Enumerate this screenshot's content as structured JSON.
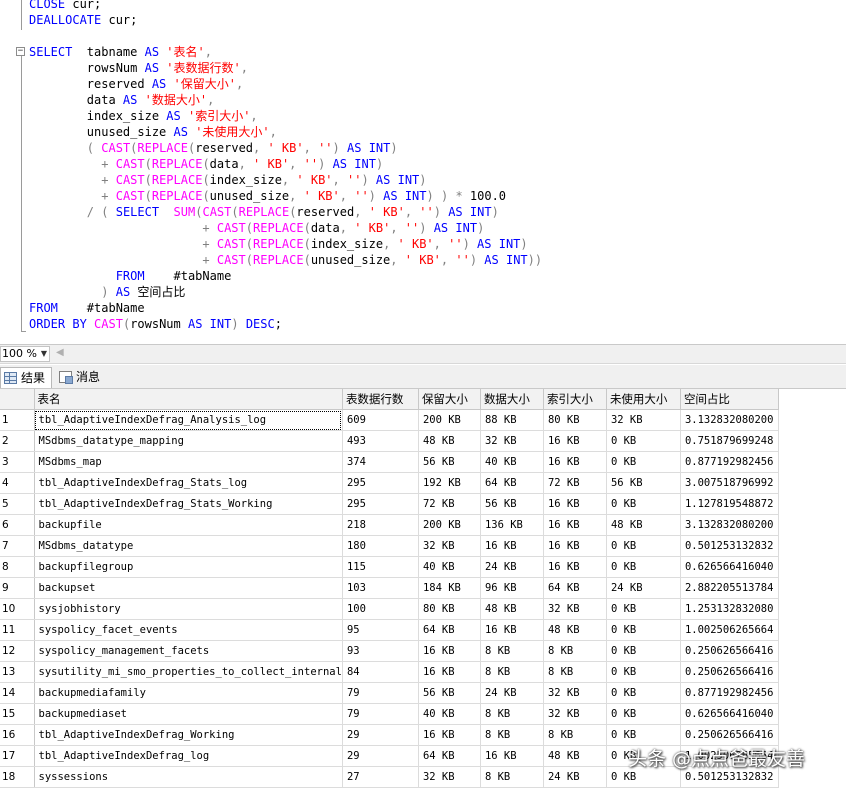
{
  "editor": {
    "lines": [
      "CLOSE cur;",
      "DEALLOCATE cur;",
      "",
      "SELECT  tabname AS '表名',",
      "        rowsNum AS '表数据行数',",
      "        reserved AS '保留大小',",
      "        data AS '数据大小',",
      "        index_size AS '索引大小',",
      "        unused_size AS '未使用大小',",
      "        ( CAST(REPLACE(reserved, ' KB', '') AS INT)",
      "          + CAST(REPLACE(data, ' KB', '') AS INT)",
      "          + CAST(REPLACE(index_size, ' KB', '') AS INT)",
      "          + CAST(REPLACE(unused_size, ' KB', '') AS INT) ) * 100.0",
      "        / ( SELECT  SUM(CAST(REPLACE(reserved, ' KB', '') AS INT)",
      "                        + CAST(REPLACE(data, ' KB', '') AS INT)",
      "                        + CAST(REPLACE(index_size, ' KB', '') AS INT)",
      "                        + CAST(REPLACE(unused_size, ' KB', '') AS INT))",
      "            FROM    #tabName",
      "          ) AS 空间占比",
      "FROM    #tabName",
      "ORDER BY CAST(rowsNum AS INT) DESC;"
    ]
  },
  "zoom": {
    "value": "100 %"
  },
  "tabs": {
    "results": "结果",
    "messages": "消息"
  },
  "grid": {
    "columns": [
      "表名",
      "表数据行数",
      "保留大小",
      "数据大小",
      "索引大小",
      "未使用大小",
      "空间占比"
    ],
    "rows": [
      [
        "1",
        "tbl_AdaptiveIndexDefrag_Analysis_log",
        "609",
        "200 KB",
        "88 KB",
        "80 KB",
        "32 KB",
        "3.132832080200"
      ],
      [
        "2",
        "MSdbms_datatype_mapping",
        "493",
        "48 KB",
        "32 KB",
        "16 KB",
        "0 KB",
        "0.751879699248"
      ],
      [
        "3",
        "MSdbms_map",
        "374",
        "56 KB",
        "40 KB",
        "16 KB",
        "0 KB",
        "0.877192982456"
      ],
      [
        "4",
        "tbl_AdaptiveIndexDefrag_Stats_log",
        "295",
        "192 KB",
        "64 KB",
        "72 KB",
        "56 KB",
        "3.007518796992"
      ],
      [
        "5",
        "tbl_AdaptiveIndexDefrag_Stats_Working",
        "295",
        "72 KB",
        "56 KB",
        "16 KB",
        "0 KB",
        "1.127819548872"
      ],
      [
        "6",
        "backupfile",
        "218",
        "200 KB",
        "136 KB",
        "16 KB",
        "48 KB",
        "3.132832080200"
      ],
      [
        "7",
        "MSdbms_datatype",
        "180",
        "32 KB",
        "16 KB",
        "16 KB",
        "0 KB",
        "0.501253132832"
      ],
      [
        "8",
        "backupfilegroup",
        "115",
        "40 KB",
        "24 KB",
        "16 KB",
        "0 KB",
        "0.626566416040"
      ],
      [
        "9",
        "backupset",
        "103",
        "184 KB",
        "96 KB",
        "64 KB",
        "24 KB",
        "2.882205513784"
      ],
      [
        "10",
        "sysjobhistory",
        "100",
        "80 KB",
        "48 KB",
        "32 KB",
        "0 KB",
        "1.253132832080"
      ],
      [
        "11",
        "syspolicy_facet_events",
        "95",
        "64 KB",
        "16 KB",
        "48 KB",
        "0 KB",
        "1.002506265664"
      ],
      [
        "12",
        "syspolicy_management_facets",
        "93",
        "16 KB",
        "8 KB",
        "8 KB",
        "0 KB",
        "0.250626566416"
      ],
      [
        "13",
        "sysutility_mi_smo_properties_to_collect_internal",
        "84",
        "16 KB",
        "8 KB",
        "8 KB",
        "0 KB",
        "0.250626566416"
      ],
      [
        "14",
        "backupmediafamily",
        "79",
        "56 KB",
        "24 KB",
        "32 KB",
        "0 KB",
        "0.877192982456"
      ],
      [
        "15",
        "backupmediaset",
        "79",
        "40 KB",
        "8 KB",
        "32 KB",
        "0 KB",
        "0.626566416040"
      ],
      [
        "16",
        "tbl_AdaptiveIndexDefrag_Working",
        "29",
        "16 KB",
        "8 KB",
        "8 KB",
        "0 KB",
        "0.250626566416"
      ],
      [
        "17",
        "tbl_AdaptiveIndexDefrag_log",
        "29",
        "64 KB",
        "16 KB",
        "48 KB",
        "0 KB",
        "1.002506265664"
      ],
      [
        "18",
        "syssessions",
        "27",
        "32 KB",
        "8 KB",
        "24 KB",
        "0 KB",
        "0.501253132832"
      ]
    ]
  },
  "watermark": "头条 @点点爸最友善",
  "colors": {
    "keyword": "#0000ff",
    "function": "#ff00ff",
    "string": "#ff0000",
    "operator": "#808080"
  }
}
